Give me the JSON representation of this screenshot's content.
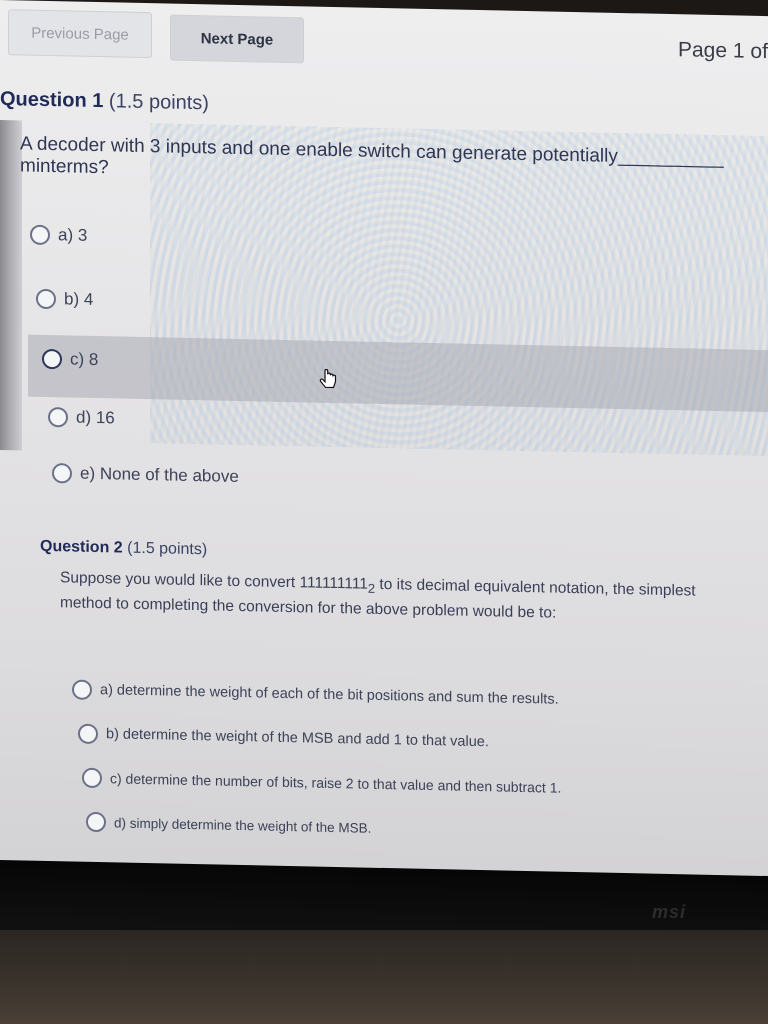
{
  "nav": {
    "previous_label": "Previous Page",
    "next_label": "Next Page",
    "page_indicator": "Page 1 of"
  },
  "questions": [
    {
      "number_label": "Question 1",
      "points": "(1.5 points)",
      "text": "A decoder with 3 inputs and one enable switch can generate potentially__________ minterms?",
      "options": [
        {
          "label": "a) 3"
        },
        {
          "label": "b) 4"
        },
        {
          "label": "c) 8"
        },
        {
          "label": "d) 16"
        },
        {
          "label": "e) None of the above"
        }
      ]
    },
    {
      "number_label": "Question 2",
      "points": "(1.5 points)",
      "text_before": "Suppose you would like to convert 111111111",
      "subscript": "2",
      "text_after": " to its decimal equivalent notation, the simplest method to completing the conversion for the above problem would be to:",
      "options": [
        {
          "label": "a) determine the weight of each of the bit positions and sum the results."
        },
        {
          "label": "b) determine the weight of the MSB and add 1 to that value."
        },
        {
          "label": "c) determine the number of bits, raise 2 to that value and then subtract 1."
        },
        {
          "label": "d) simply determine the weight of the MSB."
        }
      ]
    }
  ],
  "monitor_brand": "msi",
  "colors": {
    "title": "#1f2a57",
    "text": "#2f3552",
    "highlight_row": "#aaacb4"
  }
}
